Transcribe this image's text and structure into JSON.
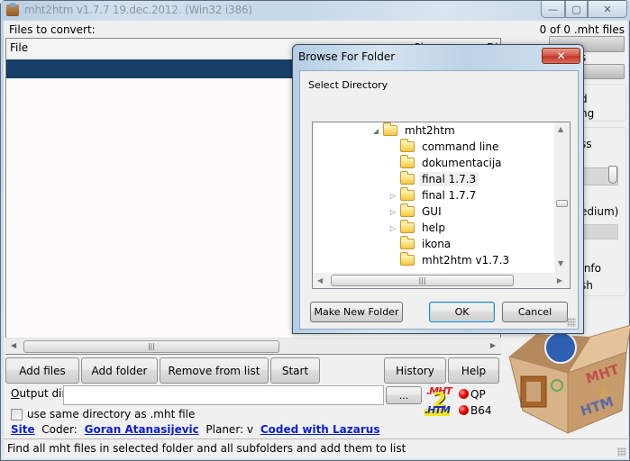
{
  "window": {
    "title": "mht2htm v1.7.7 19.dec.2012.  (Win32 i386)",
    "controls": {
      "minimize": "—",
      "maximize": "▢",
      "close": "✕"
    }
  },
  "main": {
    "files_label": "Files to convert:",
    "count_label": "0 of 0 .mht files",
    "file_list": {
      "columns": [
        "File",
        "Size",
        "Di"
      ],
      "rows": []
    },
    "buttons": {
      "add_files": "Add files",
      "add_folder": "Add folder",
      "remove": "Remove from list",
      "start": "Start",
      "history": "History",
      "help": "Help",
      "browse": "..."
    },
    "output_dir": {
      "label_accel": "O",
      "label_rest": "utput dir",
      "value": ""
    },
    "same_dir_checkbox": {
      "label": "use same directory as .mht file",
      "checked": false
    },
    "encodings": [
      {
        "label": "QP",
        "status_color": "#e00000"
      },
      {
        "label": "B64",
        "status_color": "#e00000"
      }
    ],
    "logo": {
      "top": ".MHT",
      "middle": "2",
      "bottom": ".HTM"
    },
    "links": {
      "site": "Site",
      "coder_label": "Coder:",
      "coder": "Goran Atanasijevic",
      "planer_label": "Planer: v",
      "lazarus": "Coded with Lazarus"
    },
    "status_bar": "Find all mht files in selected folder and all subfolders and add them to list",
    "right_panel_fragments": {
      "s": "s",
      "group1_line1": "d",
      "group1_line2": "ng",
      "group2_title": "ss",
      "quality": "edium)",
      "nfo": ".nfo",
      "sh": "sh"
    }
  },
  "dialog": {
    "title": "Browse For Folder",
    "close": "✕",
    "subtitle": "Select Directory",
    "tree": [
      {
        "label": "mht2htm",
        "expander": "expanded",
        "level": 0
      },
      {
        "label": "command line",
        "expander": "none",
        "level": 1
      },
      {
        "label": "dokumentacija",
        "expander": "none",
        "level": 1
      },
      {
        "label": "final 1.7.3",
        "expander": "none",
        "level": 1,
        "selected": true
      },
      {
        "label": "final 1.7.7",
        "expander": "collapsed",
        "level": 1
      },
      {
        "label": "GUI",
        "expander": "collapsed",
        "level": 1
      },
      {
        "label": "help",
        "expander": "collapsed",
        "level": 1
      },
      {
        "label": "ikona",
        "expander": "none",
        "level": 1
      },
      {
        "label": "mht2htm v1.7.3",
        "expander": "none",
        "level": 1
      }
    ],
    "buttons": {
      "make_new_folder": "Make New Folder",
      "ok": "OK",
      "cancel": "Cancel"
    }
  }
}
